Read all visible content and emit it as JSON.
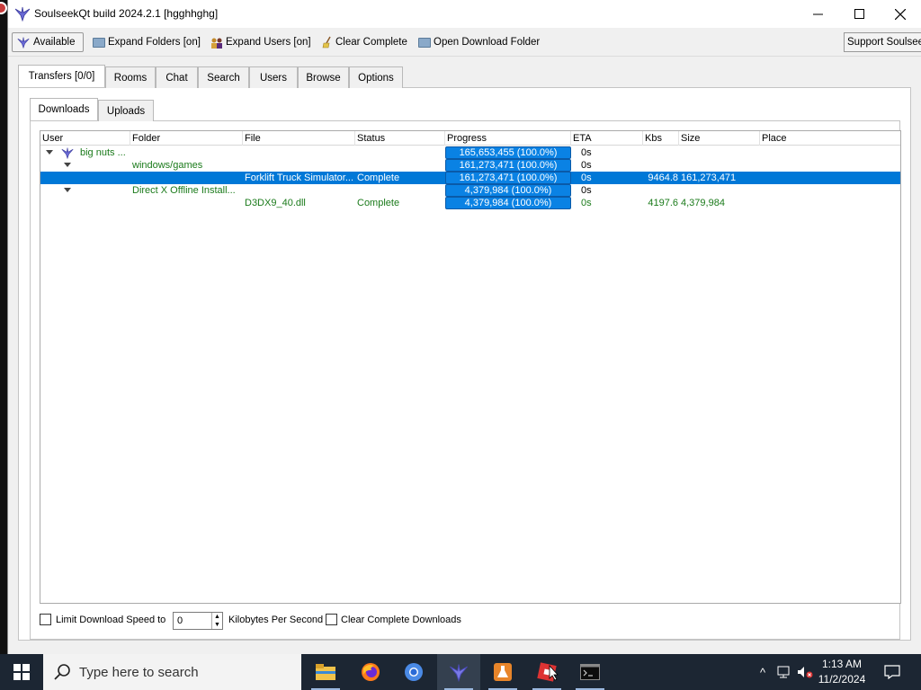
{
  "window": {
    "title": "SoulseekQt build 2024.2.1 [hgghhghg]"
  },
  "toolbar": {
    "available_label": "Available",
    "expand_folders_label": "Expand Folders [on]",
    "expand_users_label": "Expand Users [on]",
    "clear_complete_label": "Clear Complete",
    "open_download_folder_label": "Open Download Folder",
    "support_label": "Support Soulseek"
  },
  "main_tabs": [
    {
      "label": "Transfers [0/0]",
      "active": true
    },
    {
      "label": "Rooms"
    },
    {
      "label": "Chat"
    },
    {
      "label": "Search"
    },
    {
      "label": "Users"
    },
    {
      "label": "Browse"
    },
    {
      "label": "Options"
    }
  ],
  "sub_tabs": [
    {
      "label": "Downloads",
      "active": true
    },
    {
      "label": "Uploads"
    }
  ],
  "columns": [
    "User",
    "Folder",
    "File",
    "Status",
    "Progress",
    "ETA",
    "Kbs",
    "Size",
    "Place"
  ],
  "rows": [
    {
      "level": 0,
      "user": "big nuts ...",
      "folder": "",
      "file": "",
      "status": "",
      "progress": "165,653,455 (100.0%)",
      "eta": "0s",
      "kbs": "",
      "size": ""
    },
    {
      "level": 1,
      "user": "",
      "folder": "windows/games",
      "file": "",
      "status": "",
      "progress": "161,273,471 (100.0%)",
      "eta": "0s",
      "kbs": "",
      "size": ""
    },
    {
      "level": 2,
      "user": "",
      "folder": "",
      "file": "Forklift Truck Simulator...",
      "status": "Complete",
      "progress": "161,273,471 (100.0%)",
      "eta": "0s",
      "kbs": "9464.8",
      "size": "161,273,471",
      "selected": true
    },
    {
      "level": 1,
      "user": "",
      "folder": "Direct X Offline Install...",
      "file": "",
      "status": "",
      "progress": "4,379,984 (100.0%)",
      "eta": "0s",
      "kbs": "",
      "size": ""
    },
    {
      "level": 2,
      "user": "",
      "folder": "",
      "file": "D3DX9_40.dll",
      "status": "Complete",
      "progress": "4,379,984 (100.0%)",
      "eta": "0s",
      "kbs": "4197.6",
      "size": "4,379,984"
    }
  ],
  "bottom": {
    "limit_label": "Limit Download Speed to",
    "limit_value": "0",
    "unit_label": "Kilobytes Per Second",
    "clear_complete_downloads_label": "Clear Complete Downloads"
  },
  "taskbar": {
    "search_placeholder": "Type here to search",
    "time": "1:13 AM",
    "date": "11/2/2024"
  },
  "colors": {
    "selection": "#0078d7",
    "progress_fill": "#0a82e4",
    "tree_text": "#1a7a1a",
    "taskbar": "#1c2633"
  }
}
